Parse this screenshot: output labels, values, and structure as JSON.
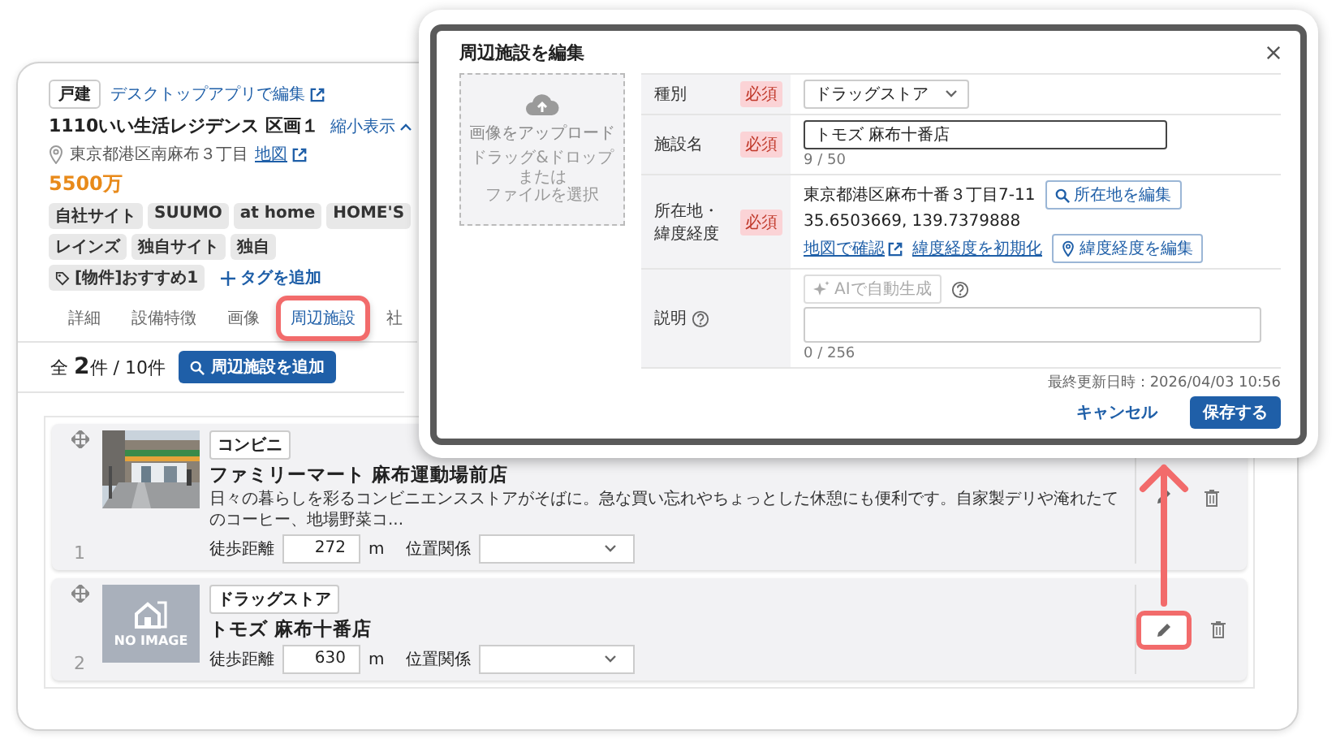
{
  "property": {
    "type_badge": "戸建",
    "edit_link": "デスクトップアプリで編集",
    "title": "1110いい生活レジデンス 区画１",
    "collapse_link": "縮小表示",
    "address": "東京都港区南麻布３丁目",
    "map_link": "地図",
    "price": "5500万",
    "portals": [
      "自社サイト",
      "SUUMO",
      "at home",
      "HOME'S",
      "レインズ",
      "独自サイト",
      "独自"
    ],
    "tags": [
      "[物件]おすすめ1"
    ],
    "add_tag": "タグを追加",
    "tabs": [
      {
        "label": "詳細",
        "selected": false,
        "highlighted": false
      },
      {
        "label": "設備特徴",
        "selected": false,
        "highlighted": false
      },
      {
        "label": "画像",
        "selected": false,
        "highlighted": false
      },
      {
        "label": "周辺施設",
        "selected": true,
        "highlighted": true
      },
      {
        "label": "社",
        "selected": false,
        "highlighted": false
      }
    ],
    "count": "全 **2**件 / 10件",
    "add_button": "周辺施設を追加",
    "facilities": [
      {
        "number": "1",
        "category": "コンビニ",
        "name": "ファミリーマート 麻布運動場前店",
        "description": "日々の暮らしを彩るコンビニエンスストアがそばに。急な買い忘れやちょっとした休憩にも便利です。自家製デリや淹れたてのコーヒー、地場野菜コ...",
        "walk_label": "徒歩距離",
        "walk_distance": "272",
        "unit": "m",
        "position_label": "位置関係",
        "edit_highlighted": false
      },
      {
        "number": "2",
        "image": {
          "kind": "placeholder",
          "text": "NO IMAGE"
        },
        "category": "ドラッグストア",
        "name": "トモズ 麻布十番店",
        "walk_label": "徒歩距離",
        "walk_distance": "630",
        "unit": "m",
        "position_label": "位置関係",
        "edit_highlighted": true
      }
    ]
  },
  "dialog": {
    "title": "周辺施設を編集",
    "upload": {
      "title": "画像をアップロード",
      "hint_lines": [
        "ドラッグ&ドロップ",
        "または",
        "ファイルを選択"
      ]
    },
    "fields": [
      {
        "kind": "select",
        "label_lines": [
          "種別"
        ],
        "required_badge": "必須",
        "value": "ドラッグストア"
      },
      {
        "kind": "text",
        "label_lines": [
          "施設名"
        ],
        "required_badge": "必須",
        "value": "トモズ 麻布十番店",
        "counter": "9 / 50"
      },
      {
        "kind": "location",
        "label_lines": [
          "所在地・",
          "緯度経度"
        ],
        "required_badge": "必須",
        "address": "東京都港区麻布十番３丁目7-11",
        "address_button": "所在地を編集",
        "coords": "35.6503669, 139.7379888",
        "links": [
          "地図で確認",
          "緯度経度を初期化"
        ],
        "coords_button": "緯度経度を編集"
      },
      {
        "kind": "textarea",
        "label_lines": [
          "説明"
        ],
        "ai_button": {
          "label": "AIで自動生成",
          "disabled": true
        },
        "counter": "0 / 256"
      }
    ],
    "updated": "最終更新日時：2026/04/03 10:56",
    "cancel": "キャンセル",
    "save": "保存する"
  }
}
